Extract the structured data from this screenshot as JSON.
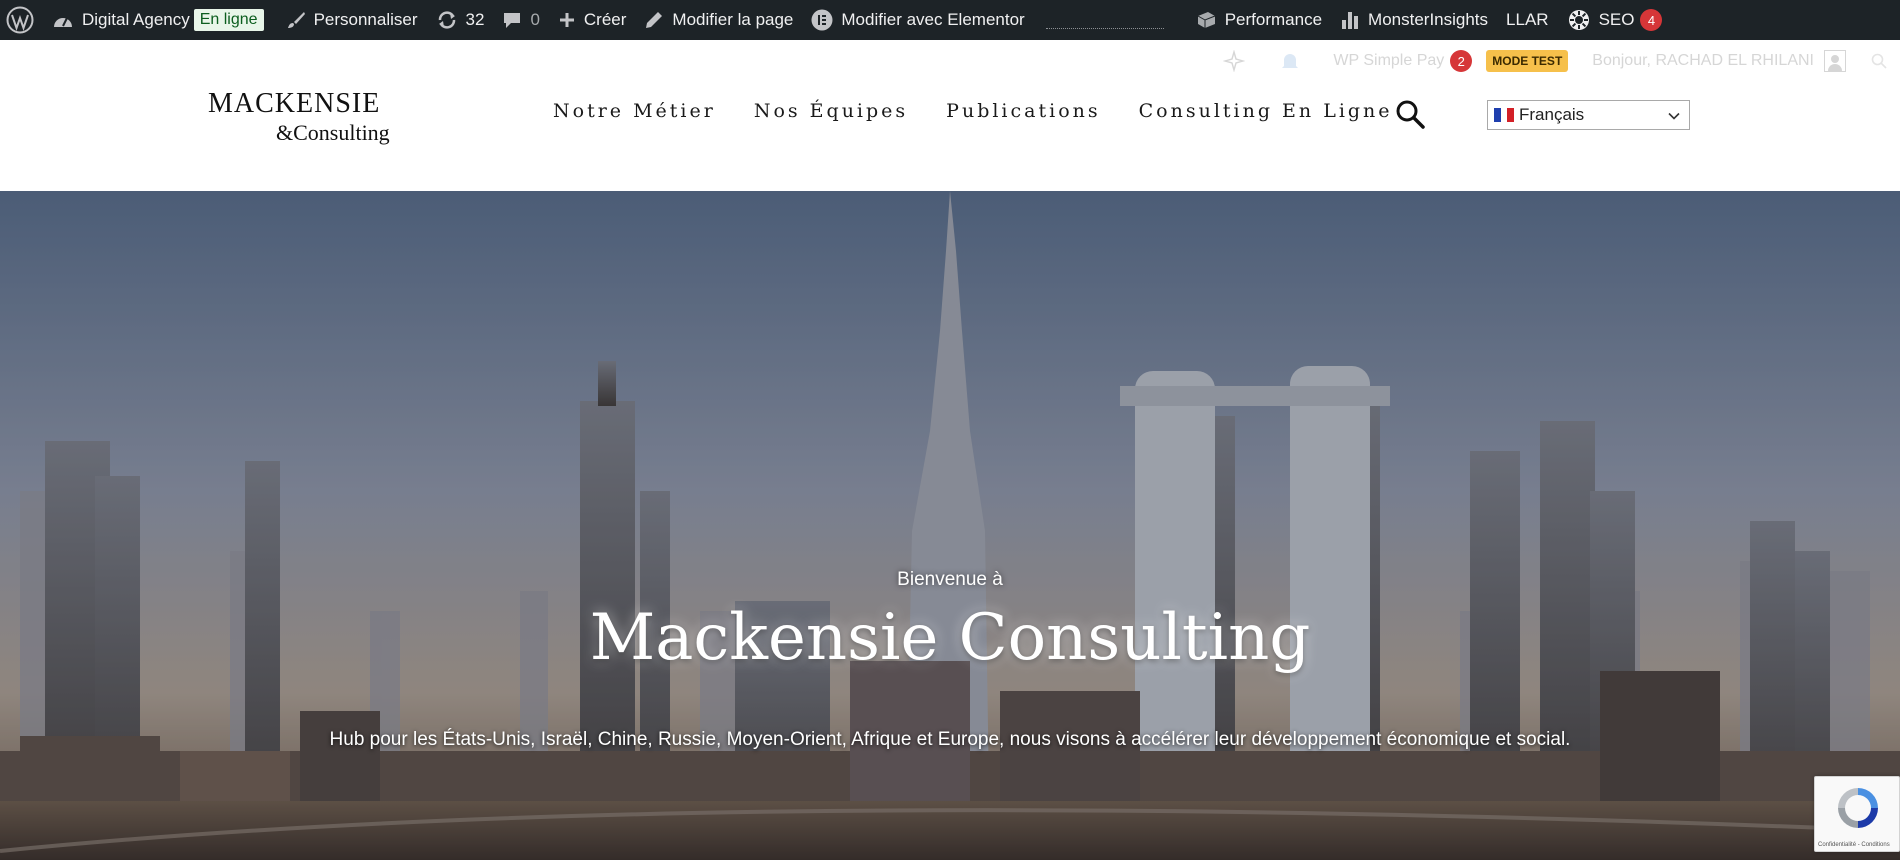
{
  "admin_bar": {
    "site_name": "Digital Agency",
    "status_badge": "En ligne",
    "customize": "Personnaliser",
    "updates_count": "32",
    "comments_count": "0",
    "create": "Créer",
    "edit_page": "Modifier la page",
    "edit_elementor": "Modifier avec Elementor",
    "performance": "Performance",
    "monsterinsights": "MonsterInsights",
    "llar": "LLAR",
    "seo": "SEO",
    "seo_count": "4"
  },
  "secondary_bar": {
    "simple_pay": "WP Simple Pay",
    "simple_pay_count": "2",
    "mode_test": "MODE TEST",
    "greeting": "Bonjour, RACHAD EL RHILANI"
  },
  "header": {
    "logo_main": "MACKENSIE",
    "logo_sub": "&Consulting",
    "nav": [
      {
        "label": "Notre Métier"
      },
      {
        "label": "Nos Équipes"
      },
      {
        "label": "Publications"
      },
      {
        "label": "Consulting En Ligne"
      }
    ],
    "language": "Français"
  },
  "hero": {
    "kicker": "Bienvenue à",
    "title": "Mackensie Consulting",
    "subtitle": "Hub pour les États-Unis, Israël, Chine, Russie, Moyen-Orient, Afrique et Europe, nous visons à accélérer leur développement économique et social."
  },
  "recaptcha": {
    "text": "Confidentialité - Conditions"
  },
  "colors": {
    "admin_bar_bg": "#1d2327",
    "badge_red": "#d63638",
    "mode_test": "#f6c04b"
  }
}
